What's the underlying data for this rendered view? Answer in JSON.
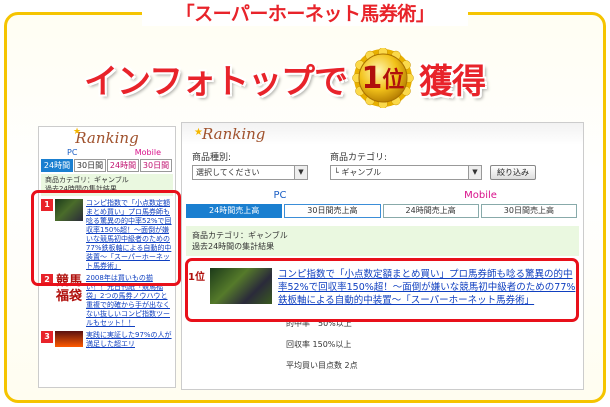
{
  "product_title": "「スーパーホーネット馬券術」",
  "headline": {
    "part1": "インフォトップで",
    "medal_number": "1",
    "medal_kanji": "位",
    "part2": "獲得"
  },
  "mobile_panel": {
    "logo": "Ranking",
    "pc_label": "PC",
    "mobile_label": "Mobile",
    "tabs": [
      "24時間",
      "30日間",
      "24時間",
      "30日間"
    ],
    "category": "商品カテゴリ：ギャンブル",
    "period": "過去24時間の集計結果",
    "items": [
      {
        "rank": "1",
        "text": "コンピ指数で「小点数定額まとめ買い」プロ馬券師も唸る驚異の的中率52%で回収率150%超！～面倒が嫌いな競馬初中級者のための77%鉄板軸による自動的中装置～「スーパーホーネット馬券術」"
      },
      {
        "rank": "2",
        "thumb_text": "競馬福袋",
        "text": "2008年は買いもの揃い！！元日刊紙「競馬福袋」2つの馬券ノウハウと重複で的確から手が出なくない抜しいコンピ指数ツールもセット！！"
      },
      {
        "rank": "3",
        "text": "実践に実証した97%の人が満足した超エリ"
      }
    ]
  },
  "pc_panel": {
    "logo": "Ranking",
    "product_type_label": "商品種別:",
    "product_type_value": "選択してください",
    "category_label": "商品カテゴリ:",
    "category_value": "└ ギャンブル",
    "narrow_button": "絞り込み",
    "pc_label": "PC",
    "mobile_label": "Mobile",
    "tabs": [
      "24時間売上高",
      "30日間売上高",
      "24時間売上高",
      "30日間売上高"
    ],
    "category": "商品カテゴリ：ギャンブル",
    "period": "過去24時間の集計結果",
    "top_item": {
      "rank": "1位",
      "title": "コンピ指数で「小点数定額まとめ買い」プロ馬券師も唸る驚異の的中率52%で回収率150%超！～面倒が嫌いな競馬初中級者のための77%鉄板軸による自動的中装置～「スーパーホーネット馬券術」"
    },
    "stats": [
      "的中率　50%以上",
      "回収率 150%以上",
      "平均買い目点数 2点"
    ]
  }
}
